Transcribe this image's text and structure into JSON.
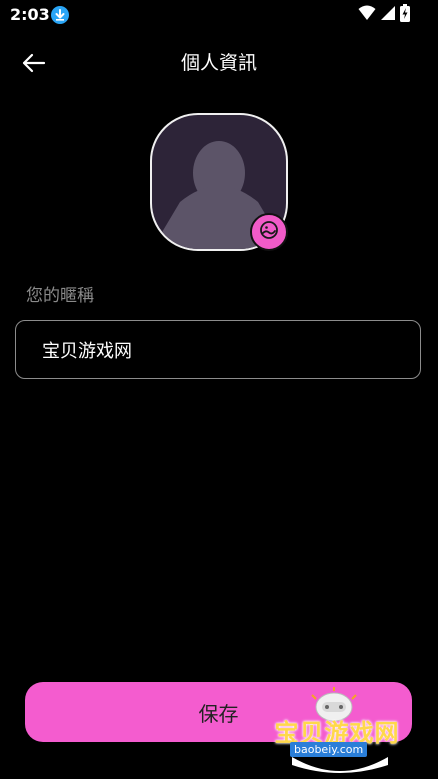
{
  "status_bar": {
    "time": "2:03",
    "download_icon": "download-icon",
    "wifi_icon": "wifi-icon",
    "signal_icon": "signal-icon",
    "battery_icon": "battery-charging-icon"
  },
  "header": {
    "back_icon": "arrow-left-icon",
    "title": "個人資訊"
  },
  "profile": {
    "avatar_icon": "default-user-silhouette",
    "edit_photo_icon": "image-edit-icon"
  },
  "form": {
    "nickname_label": "您的暱稱",
    "nickname_value": "宝贝游戏网"
  },
  "actions": {
    "save_label": "保存"
  },
  "watermark": {
    "text": "宝贝游戏网",
    "url": "baobeiy.com"
  },
  "colors": {
    "background": "#000000",
    "accent": "#f45ccf",
    "field_border": "#8c8c8c",
    "label_gray": "#8a8a8a"
  }
}
